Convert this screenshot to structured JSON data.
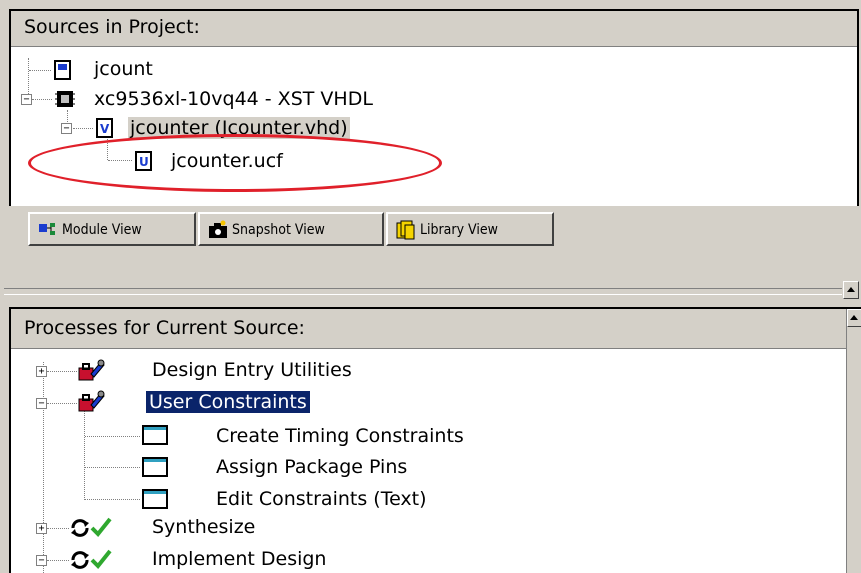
{
  "sources": {
    "header": "Sources in Project:",
    "items": [
      {
        "label": "jcount",
        "icon": "project-file-icon"
      },
      {
        "label": "xc9536xl-10vq44 - XST VHDL",
        "icon": "chip-icon"
      },
      {
        "label": "jcounter (Jcounter.vhd)",
        "icon": "vhdl-file-icon"
      },
      {
        "label": "jcounter.ucf",
        "icon": "ucf-file-icon"
      }
    ]
  },
  "tabs": [
    {
      "label": "Module View",
      "icon": "module-view-icon"
    },
    {
      "label": "Snapshot View",
      "icon": "snapshot-camera-icon"
    },
    {
      "label": "Library View",
      "icon": "library-books-icon"
    }
  ],
  "processes": {
    "header": "Processes for Current Source:",
    "items": [
      {
        "label": "Design Entry Utilities",
        "expander": "+"
      },
      {
        "label": "User Constraints",
        "expander": "-"
      },
      {
        "label": "Create Timing Constraints"
      },
      {
        "label": "Assign Package Pins"
      },
      {
        "label": "Edit Constraints (Text)"
      },
      {
        "label": "Synthesize",
        "expander": "+"
      },
      {
        "label": "Implement Design",
        "expander": "-"
      }
    ]
  },
  "colors": {
    "selection": "#0a246a",
    "annotation": "#e0202a",
    "check": "#2fa82f",
    "tool_red": "#c8102e"
  }
}
